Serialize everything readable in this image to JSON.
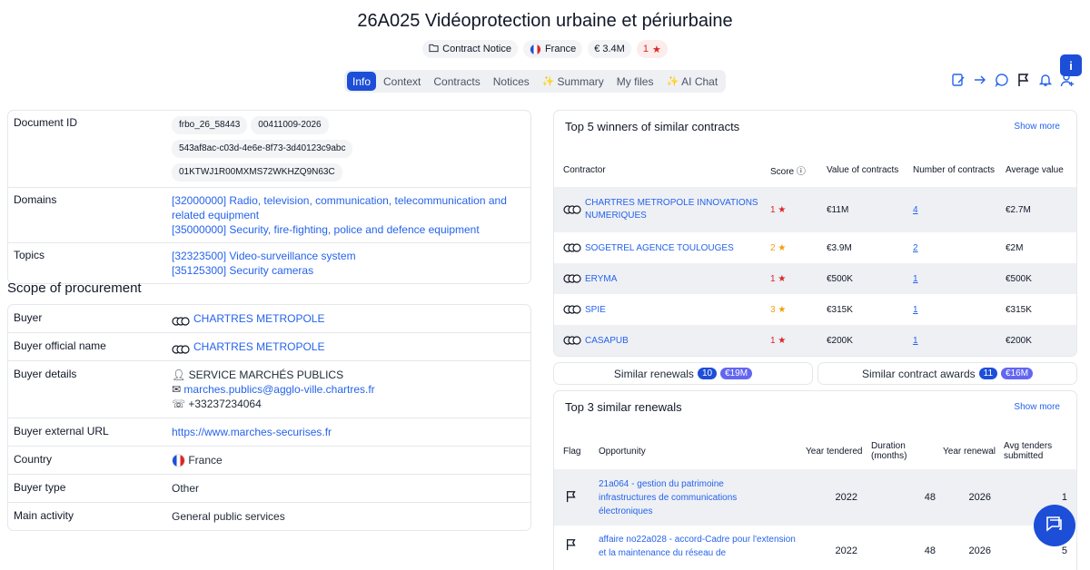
{
  "header": {
    "title": "26A025 Vidéoprotection urbaine et périurbaine",
    "badges": {
      "notice": "Contract Notice",
      "country": "France",
      "value": "€ 3.4M",
      "rating": "1"
    }
  },
  "tabs": [
    {
      "label": "Info"
    },
    {
      "label": "Context"
    },
    {
      "label": "Contracts"
    },
    {
      "label": "Notices"
    },
    {
      "label": "Summary"
    },
    {
      "label": "My files"
    },
    {
      "label": "AI Chat"
    }
  ],
  "info_button": "i",
  "details": {
    "document_id_label": "Document ID",
    "document_ids": [
      "frbo_26_58443",
      "00411009-2026",
      "543af8ac-c03d-4e6e-8f73-3d40123c9abc",
      "01KTWJ1R00MXMS72WKHZQ9N63C"
    ],
    "domains_label": "Domains",
    "domains": [
      "[32000000] Radio, television, communication, telecommunication and related equipment",
      "[35000000] Security, fire-fighting, police and defence equipment"
    ],
    "topics_label": "Topics",
    "topics": [
      "[32323500] Video-surveillance system",
      "[35125300] Security cameras"
    ]
  },
  "scope": {
    "title": "Scope of procurement",
    "buyer_label": "Buyer",
    "buyer": "CHARTRES METROPOLE",
    "buyer_official_label": "Buyer official name",
    "buyer_official": "CHARTRES METROPOLE",
    "buyer_details_label": "Buyer details",
    "buyer_department": "SERVICE MARCHÉS PUBLICS",
    "buyer_email": "marches.publics@agglo-ville.chartres.fr",
    "buyer_phone": "+33237234064",
    "buyer_url_label": "Buyer external URL",
    "buyer_url": "https://www.marches-securises.fr",
    "country_label": "Country",
    "country": "France",
    "buyer_type_label": "Buyer type",
    "buyer_type": "Other",
    "main_activity_label": "Main activity",
    "main_activity": "General public services"
  },
  "winners": {
    "title": "Top 5 winners of similar contracts",
    "show_more": "Show more",
    "headers": {
      "contractor": "Contractor",
      "score": "Score",
      "value": "Value of contracts",
      "number": "Number of contracts",
      "average": "Average value"
    },
    "rows": [
      {
        "name": "CHARTRES METROPOLE INNOVATIONS NUMERIQUES",
        "score": "1",
        "value": "€11M",
        "number": "4",
        "average": "€2.7M"
      },
      {
        "name": "SOGETREL AGENCE TOULOUGES",
        "score": "2",
        "value": "€3.9M",
        "number": "2",
        "average": "€2M"
      },
      {
        "name": "ERYMA",
        "score": "1",
        "value": "€500K",
        "number": "1",
        "average": "€500K"
      },
      {
        "name": "SPIE",
        "score": "3",
        "value": "€315K",
        "number": "1",
        "average": "€315K"
      },
      {
        "name": "CASAPUB",
        "score": "1",
        "value": "€200K",
        "number": "1",
        "average": "€200K"
      }
    ]
  },
  "similar": {
    "renewals_label": "Similar renewals",
    "renewals_count": "10",
    "renewals_amount": "€19M",
    "awards_label": "Similar contract awards",
    "awards_count": "11",
    "awards_amount": "€16M"
  },
  "renewals": {
    "title": "Top 3 similar renewals",
    "show_more": "Show more",
    "headers": {
      "flag": "Flag",
      "opportunity": "Opportunity",
      "year_tendered": "Year tendered",
      "duration": "Duration (months)",
      "year_renewal": "Year renewal",
      "avg_tenders": "Avg tenders submitted"
    },
    "rows": [
      {
        "opportunity": "21a064 - gestion du patrimoine infrastructures de communications électroniques",
        "year_tendered": "2022",
        "duration": "48",
        "year_renewal": "2026",
        "avg": "1"
      },
      {
        "opportunity": "affaire no22a028 - accord-Cadre pour l'extension et la maintenance du réseau de",
        "year_tendered": "2022",
        "duration": "48",
        "year_renewal": "2026",
        "avg": "5"
      }
    ]
  }
}
